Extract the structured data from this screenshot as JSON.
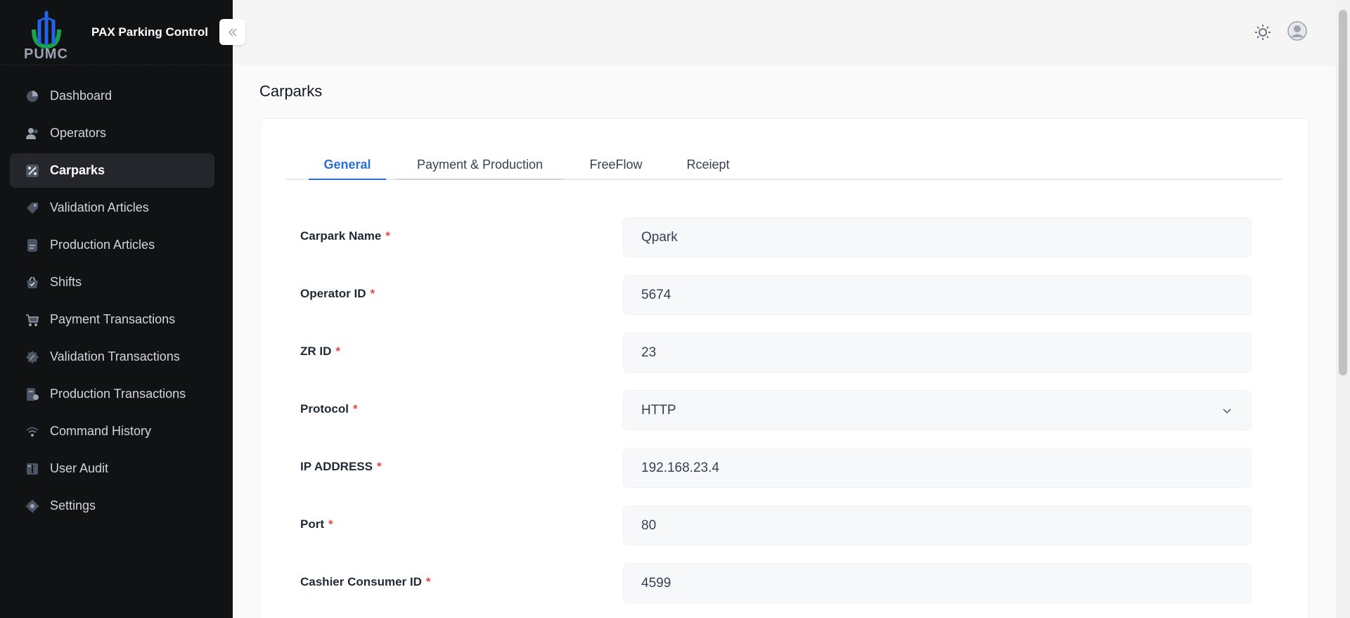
{
  "brand": {
    "logo_text": "PUMC",
    "title": "PAX Parking Control"
  },
  "sidebar": {
    "items": [
      {
        "label": "Dashboard",
        "icon": "pie-chart-icon",
        "active": false
      },
      {
        "label": "Operators",
        "icon": "users-icon",
        "active": false
      },
      {
        "label": "Carparks",
        "icon": "percent-icon",
        "active": true
      },
      {
        "label": "Validation Articles",
        "icon": "tag-icon",
        "active": false
      },
      {
        "label": "Production Articles",
        "icon": "document-icon",
        "active": false
      },
      {
        "label": "Shifts",
        "icon": "basket-icon",
        "active": false
      },
      {
        "label": "Payment Transactions",
        "icon": "cart-icon",
        "active": false
      },
      {
        "label": "Validation Transactions",
        "icon": "discount-icon",
        "active": false
      },
      {
        "label": "Production Transactions",
        "icon": "receipt-icon",
        "active": false
      },
      {
        "label": "Command History",
        "icon": "wifi-icon",
        "active": false
      },
      {
        "label": "User Audit",
        "icon": "book-icon",
        "active": false
      },
      {
        "label": "Settings",
        "icon": "gear-icon",
        "active": false
      }
    ]
  },
  "main": {
    "page_title": "Carparks",
    "tabs": [
      {
        "label": "General",
        "active": true
      },
      {
        "label": "Payment & Production",
        "active": false
      },
      {
        "label": "FreeFlow",
        "active": false
      },
      {
        "label": "Rceiept",
        "active": false
      }
    ],
    "form": {
      "fields": [
        {
          "label": "Carpark Name",
          "required_mark": "*",
          "value": "Qpark",
          "type": "text"
        },
        {
          "label": "Operator ID",
          "required_mark": "*",
          "value": "5674",
          "type": "text"
        },
        {
          "label": "ZR ID",
          "required_mark": "*",
          "value": "23",
          "type": "text"
        },
        {
          "label": "Protocol",
          "required_mark": "*",
          "value": "HTTP",
          "type": "select"
        },
        {
          "label": "IP ADDRESS",
          "required_mark": "*",
          "value": "192.168.23.4",
          "type": "text"
        },
        {
          "label": "Port",
          "required_mark": "*",
          "value": "80",
          "type": "text"
        },
        {
          "label": "Cashier Consumer ID",
          "required_mark": "*",
          "value": "4599",
          "type": "text"
        }
      ]
    }
  },
  "colors": {
    "sidebar_bg": "#111214",
    "accent": "#2b6fd6",
    "required": "#ef4444",
    "logo_green": "#16a34a",
    "logo_blue": "#2563eb"
  }
}
